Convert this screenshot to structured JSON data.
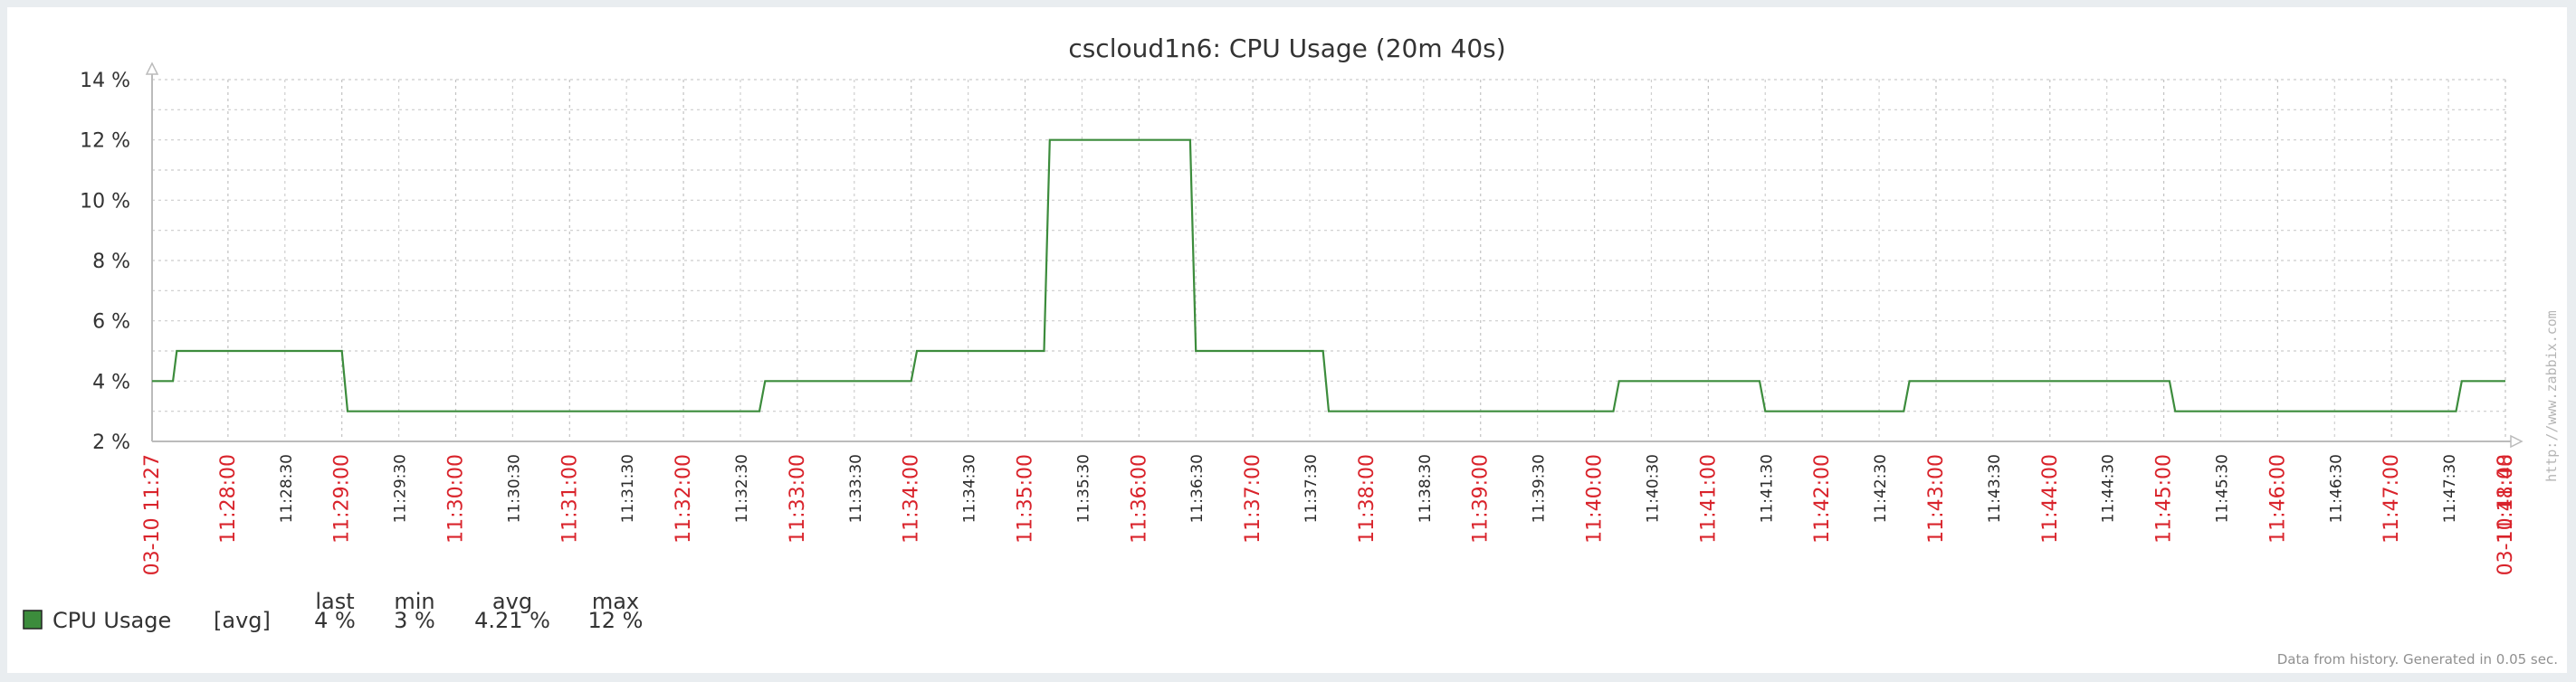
{
  "chart_data": {
    "type": "line",
    "title": "cscloud1n6: CPU Usage (20m 40s)",
    "xlabel": "",
    "ylabel": "",
    "ylim": [
      2,
      14
    ],
    "yticks": [
      2,
      4,
      6,
      8,
      10,
      12,
      14
    ],
    "ytick_suffix": " %",
    "grid": true,
    "x_start_label": "03-10 11:27",
    "x_end_label": "03-10 11:48",
    "x_start": "11:27:20",
    "x_end": "11:48:00",
    "x_tick_labels": [
      "11:28:00",
      "11:28:30",
      "11:29:00",
      "11:29:30",
      "11:30:00",
      "11:30:30",
      "11:31:00",
      "11:31:30",
      "11:32:00",
      "11:32:30",
      "11:33:00",
      "11:33:30",
      "11:34:00",
      "11:34:30",
      "11:35:00",
      "11:35:30",
      "11:36:00",
      "11:36:30",
      "11:37:00",
      "11:37:30",
      "11:38:00",
      "11:38:30",
      "11:39:00",
      "11:39:30",
      "11:40:00",
      "11:40:30",
      "11:41:00",
      "11:41:30",
      "11:42:00",
      "11:42:30",
      "11:43:00",
      "11:43:30",
      "11:44:00",
      "11:44:30",
      "11:45:00",
      "11:45:30",
      "11:46:00",
      "11:46:30",
      "11:47:00",
      "11:47:30",
      "11:48:00"
    ],
    "series": [
      {
        "name": "CPU Usage",
        "color": "#3c8c3c",
        "x": [
          "11:27:20",
          "11:27:31",
          "11:27:33",
          "11:29:00",
          "11:29:03",
          "11:32:40",
          "11:32:43",
          "11:34:00",
          "11:34:03",
          "11:35:10",
          "11:35:13",
          "11:36:27",
          "11:36:30",
          "11:37:37",
          "11:37:40",
          "11:40:10",
          "11:40:13",
          "11:41:27",
          "11:41:30",
          "11:42:43",
          "11:42:46",
          "11:45:03",
          "11:45:06",
          "11:47:34",
          "11:47:37",
          "11:48:00"
        ],
        "y": [
          4,
          4,
          5,
          5,
          3,
          3,
          4,
          4,
          5,
          5,
          12,
          12,
          5,
          5,
          3,
          3,
          4,
          4,
          3,
          3,
          4,
          4,
          3,
          3,
          4,
          4
        ]
      }
    ],
    "legend": {
      "position": "bottom-left",
      "headers": {
        "last": "last",
        "min": "min",
        "avg": "avg",
        "max": "max"
      },
      "rows": [
        {
          "name": "CPU Usage",
          "func": "[avg]",
          "last": "4 %",
          "min": "3 %",
          "avg": "4.21 %",
          "max": "12 %",
          "color": "#3c8c3c"
        }
      ]
    },
    "watermark": "http://www.zabbix.com",
    "footer": "Data from history. Generated in 0.05 sec."
  }
}
